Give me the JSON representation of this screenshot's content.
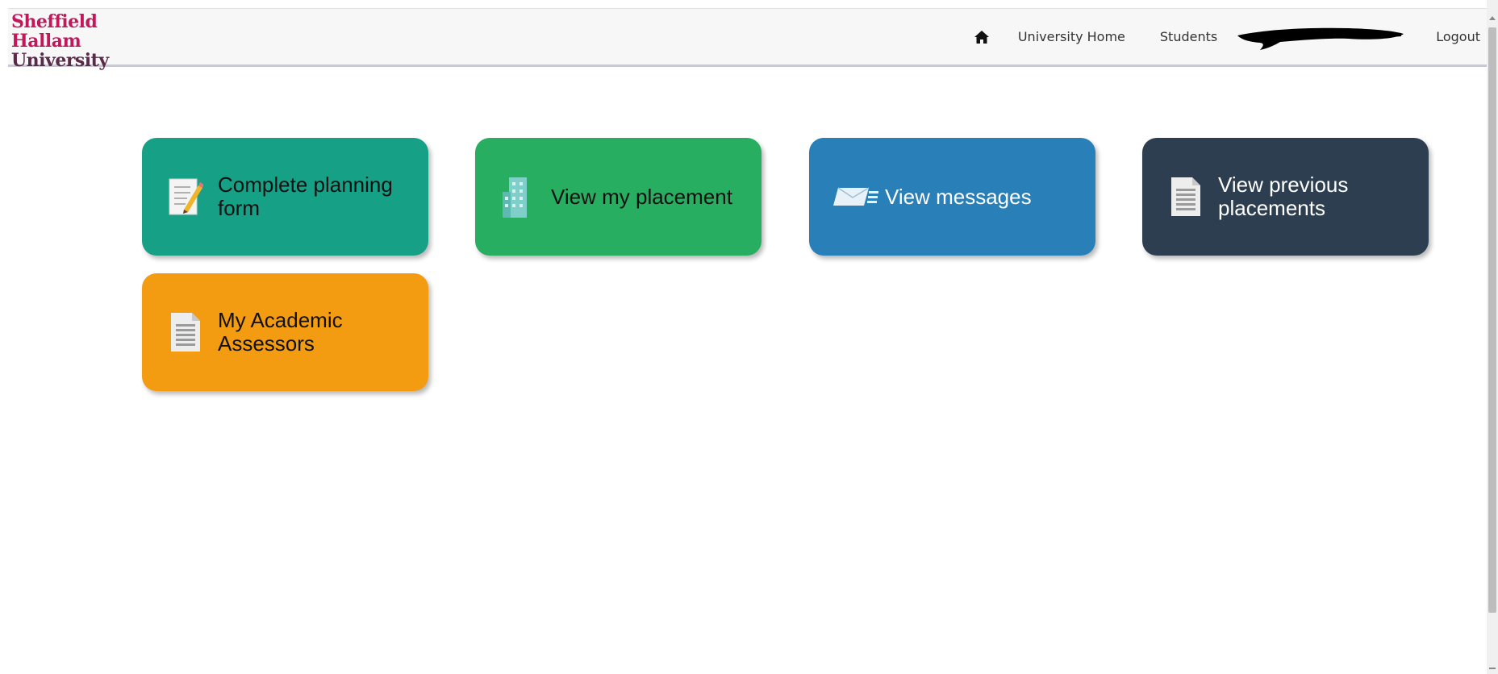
{
  "header": {
    "logo": {
      "line1": "Sheffield",
      "line2": "Hallam",
      "line3": "University"
    },
    "nav": {
      "home_icon": "home-icon",
      "university_home": "University Home",
      "students": "Students",
      "logout": "Logout"
    }
  },
  "tiles": [
    {
      "label": "Complete planning form",
      "icon": "form-edit-icon",
      "color": "#16a085"
    },
    {
      "label": "View my placement",
      "icon": "building-icon",
      "color": "#27ae60"
    },
    {
      "label": "View messages",
      "icon": "messages-icon",
      "color": "#2980b9"
    },
    {
      "label": "View previous placements",
      "icon": "document-icon",
      "color": "#2c3e50"
    },
    {
      "label": "My Academic Assessors",
      "icon": "document-icon",
      "color": "#f39c12"
    }
  ],
  "colors": {
    "brand_primary": "#c2185b",
    "brand_secondary": "#5a2a4a",
    "header_bg": "#f7f7f7"
  }
}
